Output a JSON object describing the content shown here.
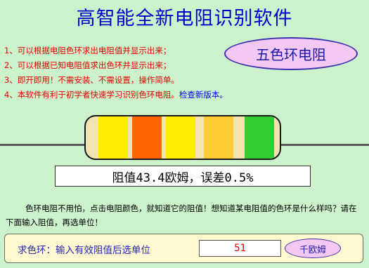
{
  "app": {
    "title": "高智能全新电阻识别软件"
  },
  "features": [
    "1、可以根据电阻色环求出电阻值并显示出来；",
    "2、可以根据已知电阻值求出色环并显示出来；",
    "3、即开即用！不需安装、不需设置，操作简单。",
    "4、本软件有利于初学者快速学习识别色环电阻。"
  ],
  "check_update_link": "检查新版本。",
  "mode_button_label": "五色环电阻",
  "resistor": {
    "band_colors": [
      "#ffee00",
      "#ff6600",
      "#ffee00",
      "#ffcc33",
      "#33cc33"
    ],
    "band_names": [
      "yellow",
      "orange",
      "yellow",
      "gold",
      "green"
    ]
  },
  "result_text": "阻值43.4欧姆，误差0.5%",
  "instructions": "色环电阻不用怕，点击电阻颜色，就知道它的阻值！想知道某电阻值的色环是什么样吗？请在下面输入阻值，再选单位！",
  "query": {
    "label": "求色环：输入有效阻值后选单位",
    "value": "51",
    "unit_button_label": "千欧姆"
  },
  "colors": {
    "background": "#ccf2cc",
    "title": "#0000cc",
    "feature_text": "#e60000",
    "button_fill": "#f4c8f4",
    "resistor_body": "#f1e4b0",
    "panel_fill": "#fff9d2"
  }
}
